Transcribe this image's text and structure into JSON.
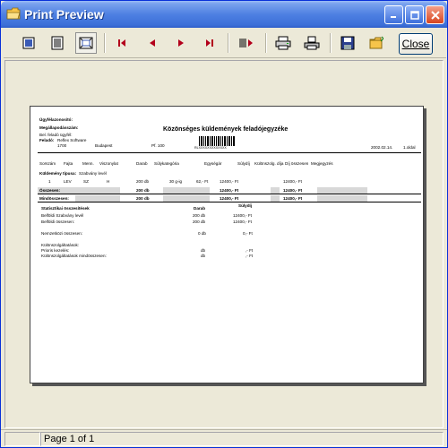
{
  "window": {
    "title": "Print Preview"
  },
  "toolbar": {
    "tools": [
      {
        "name": "single-page-view-icon"
      },
      {
        "name": "page-width-view-icon"
      },
      {
        "name": "zoom-fit-icon"
      },
      {
        "name": "first-page-icon"
      },
      {
        "name": "previous-page-icon"
      },
      {
        "name": "next-page-icon"
      },
      {
        "name": "last-page-icon"
      },
      {
        "name": "go-to-page-icon"
      },
      {
        "name": "printer-setup-icon"
      },
      {
        "name": "print-icon"
      },
      {
        "name": "save-icon"
      },
      {
        "name": "open-icon"
      }
    ],
    "close_label": "Close"
  },
  "report": {
    "header": {
      "id_label": "Ügyfélazonosító:",
      "contract_label": "Megállapodásszám:",
      "bank_label": "Bel. feladó ügyfél:",
      "sender_label": "Feladó:",
      "sender_name": "Reflex Software",
      "sender_zip": "1700",
      "sender_city": "Budapest",
      "sender_pf": "Pf. 100",
      "title": "Közönséges küldemények feladójegyzéke",
      "barcode_text": "RLXXXXXXXXXXXXX",
      "date": "2002.02.14.",
      "page": "1.oldal"
    },
    "columns": [
      "Sorszám",
      "Fajta",
      "Menn.",
      "Viszonylat",
      "Darab",
      "Súlykategória",
      "Egységár",
      "Súlydíj",
      "Különszolg. díja",
      "Díj összesen",
      "Megjegyzés"
    ],
    "shipment_type_label": "Küldemény típusa:",
    "shipment_type": "Szabvány levél",
    "row": {
      "no": "1",
      "kind": "LEV",
      "qty": "SZ",
      "rel": "H",
      "count": "200 db",
      "weight": "30 g-ig",
      "unit": "62,- Ft",
      "fee": "12400,- Ft",
      "total": "12400,- Ft"
    },
    "subtotal": {
      "label": "Összesen:",
      "count": "200 db",
      "fee": "12400,- Ft",
      "total": "12400,- Ft"
    },
    "grandtotal": {
      "label": "Mindösszesen:",
      "count": "200 db",
      "fee": "12400,- Ft",
      "total": "12400,- Ft"
    },
    "stats": {
      "title": "Statisztikai összesítések",
      "col_count": "Darab",
      "col_fee": "Súlydíj",
      "rows": [
        {
          "label": "Belföldi Szabvány levél",
          "count": "200 db",
          "fee": "12400,- Ft"
        },
        {
          "label": "Belföldi összesen:",
          "count": "200 db",
          "fee": "12400,- Ft"
        },
        {
          "label": "Nemzetközi összesen:",
          "count": "0 db",
          "fee": "0,- Ft"
        }
      ],
      "extra_title": "Különszolgáltatások:",
      "extra_rows": [
        {
          "label": "Prioris kezelés:",
          "count": "db",
          "fee": ",- Ft"
        },
        {
          "label": "Különszolgáltatások mindösszesen:",
          "count": "db",
          "fee": ",- Ft"
        }
      ]
    }
  },
  "status": {
    "page": "Page 1 of 1"
  }
}
